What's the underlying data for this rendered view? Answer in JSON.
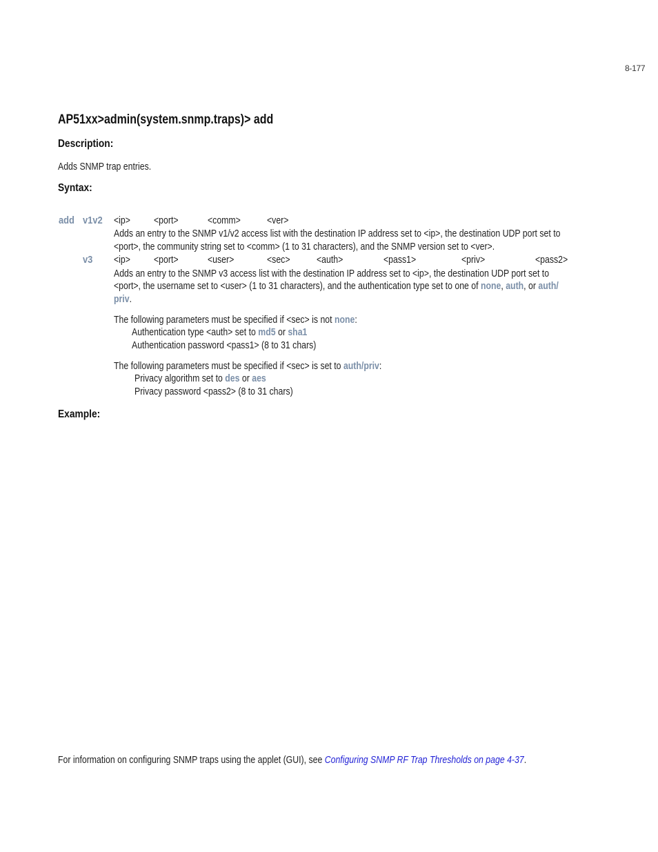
{
  "page_number": "8-177",
  "command_title": "AP51xx>admin(system.snmp.traps)> add",
  "description": {
    "heading": "Description:",
    "text": "Adds SNMP trap entries."
  },
  "syntax": {
    "heading": "Syntax:",
    "command": "add",
    "v1v2": {
      "keyword": "v1v2",
      "params": [
        "<ip>",
        "<port>",
        "<comm>",
        "<ver>"
      ],
      "desc_lines": [
        "Adds an entry to the SNMP v1/v2 access list with the destination IP address set to <ip>, the destination UDP port set to",
        "<port>, the community string set to <comm> (1 to 31 characters), and the SNMP version set to <ver>."
      ]
    },
    "v3": {
      "keyword": "v3",
      "params": [
        "<ip>",
        "<port>",
        "<user>",
        "<sec>",
        "<auth>",
        "<pass1>",
        "<priv>",
        "<pass2>"
      ],
      "desc_line1": "Adds an entry to the SNMP v3 access list with the destination IP address set to <ip>, the destination UDP port set to",
      "desc_line2_prefix": "<port>, the username set to <user> (1 to 31 characters), and the authentication type set to one of ",
      "desc_kw_none": "none",
      "desc_sep1": ", ",
      "desc_kw_auth": "auth",
      "desc_sep2": ", or ",
      "desc_kw_authpriv_a": "auth/",
      "desc_kw_authpriv_b": "priv",
      "desc_end": "."
    },
    "note1": {
      "prefix": "The following parameters must be specified if <sec> is not ",
      "kw": "none",
      "suffix": ":",
      "line1_prefix": "Authentication type <auth> set to ",
      "line1_kw1": "md5",
      "line1_or": " or ",
      "line1_kw2": "sha1",
      "line2": "Authentication password <pass1> (8 to 31 chars)"
    },
    "note2": {
      "prefix": "The following parameters must be specified if <sec> is set to ",
      "kw": "auth/priv",
      "suffix": ":",
      "line1_prefix": "Privacy algorithm set to ",
      "line1_kw1": "des",
      "line1_or": " or ",
      "line1_kw2": "aes",
      "line2": "Privacy password <pass2> (8 to 31 chars)"
    }
  },
  "example": {
    "heading": "Example:"
  },
  "footer_note": {
    "prefix": "For information on configuring SNMP traps using the applet (GUI), see ",
    "link_text": "Configuring SNMP RF Trap Thresholds on page 4-37",
    "suffix": "."
  },
  "colors": {
    "keyword": "#7b8fa8",
    "link": "#2323d6",
    "text": "#222222"
  }
}
